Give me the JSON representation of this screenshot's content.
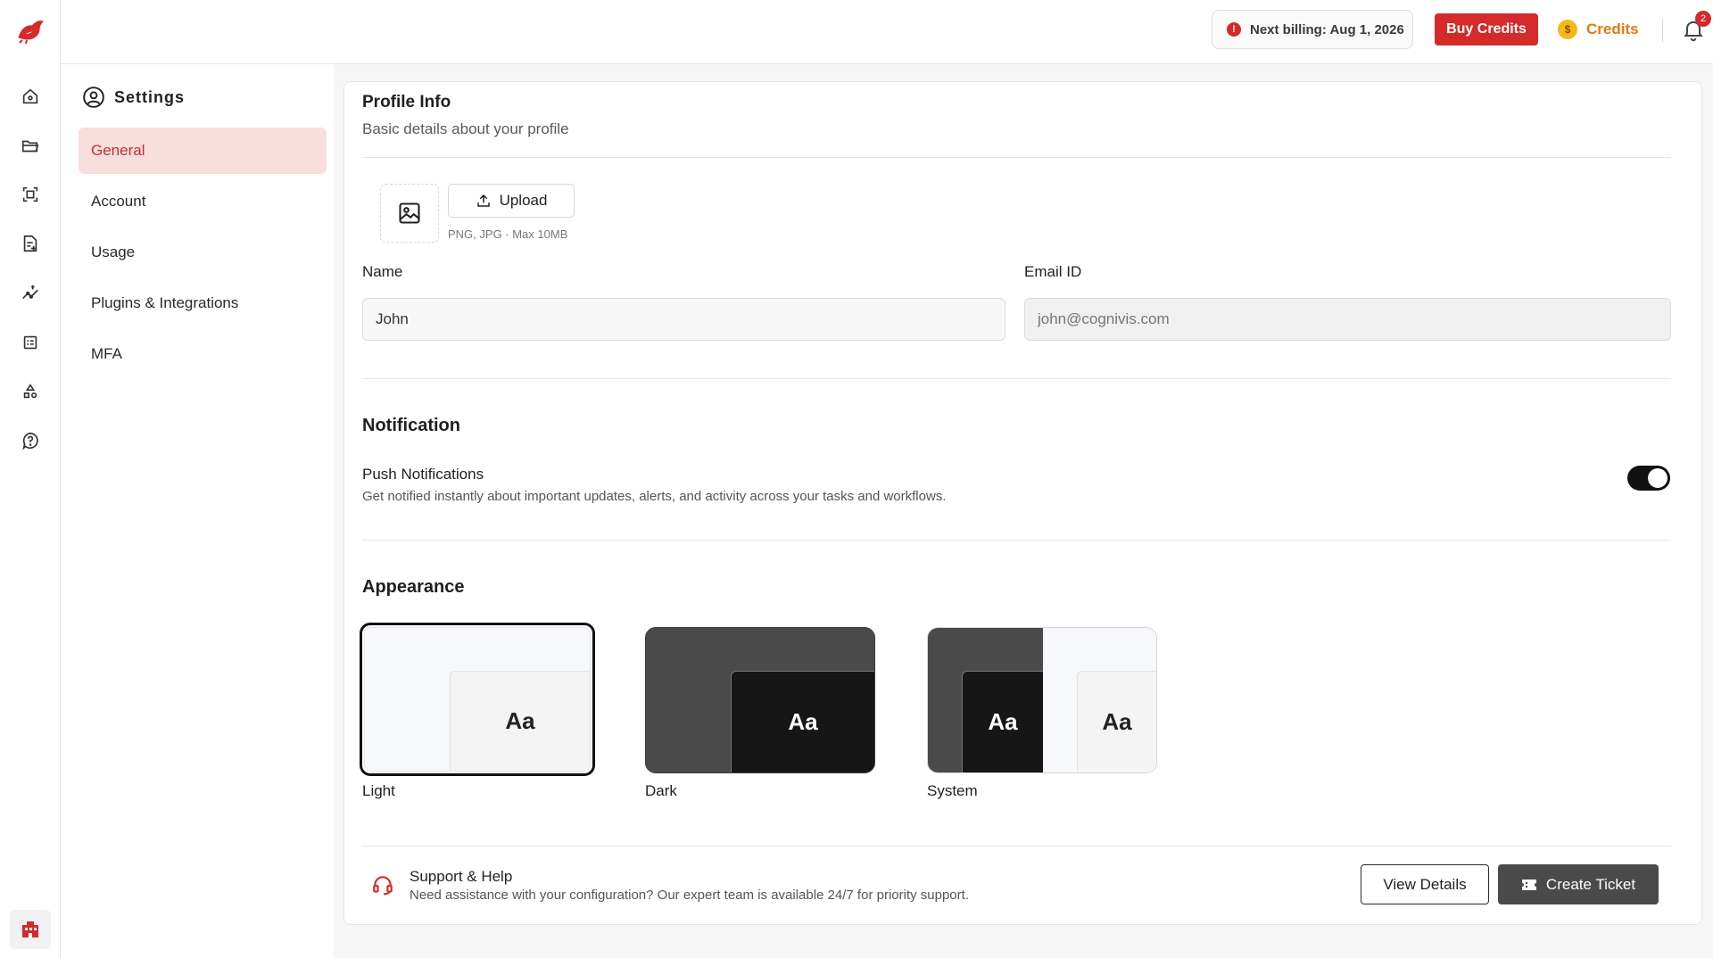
{
  "header": {
    "billing_text": "Next billing: Aug 1, 2026",
    "buy_credits_label": "Buy Credits",
    "credits_label": "Credits",
    "notification_count": "2"
  },
  "settings": {
    "title": "Settings",
    "nav": [
      {
        "label": "General",
        "active": true
      },
      {
        "label": "Account"
      },
      {
        "label": "Usage"
      },
      {
        "label": "Plugins & Integrations"
      },
      {
        "label": "MFA"
      }
    ]
  },
  "profile": {
    "title": "Profile Info",
    "subtitle": "Basic details about your profile",
    "upload_label": "Upload",
    "upload_hint": "PNG, JPG · Max 10MB",
    "name_label": "Name",
    "name_value": "John",
    "email_label": "Email ID",
    "email_placeholder": "john@cognivis.com"
  },
  "notification": {
    "title": "Notification",
    "push_title": "Push Notifications",
    "push_desc": "Get notified instantly about important updates, alerts, and activity across your tasks and workflows.",
    "push_enabled": true
  },
  "appearance": {
    "title": "Appearance",
    "sample": "Aa",
    "options": [
      {
        "label": "Light",
        "selected": true
      },
      {
        "label": "Dark"
      },
      {
        "label": "System"
      }
    ]
  },
  "support": {
    "title": "Support & Help",
    "desc": "Need assistance with your configuration? Our expert team is available 24/7 for priority support.",
    "view_details_label": "View Details",
    "create_ticket_label": "Create Ticket"
  },
  "colors": {
    "accent": "#d42a2a",
    "active_nav_bg": "#f9dede",
    "credits": "#e07a10"
  }
}
